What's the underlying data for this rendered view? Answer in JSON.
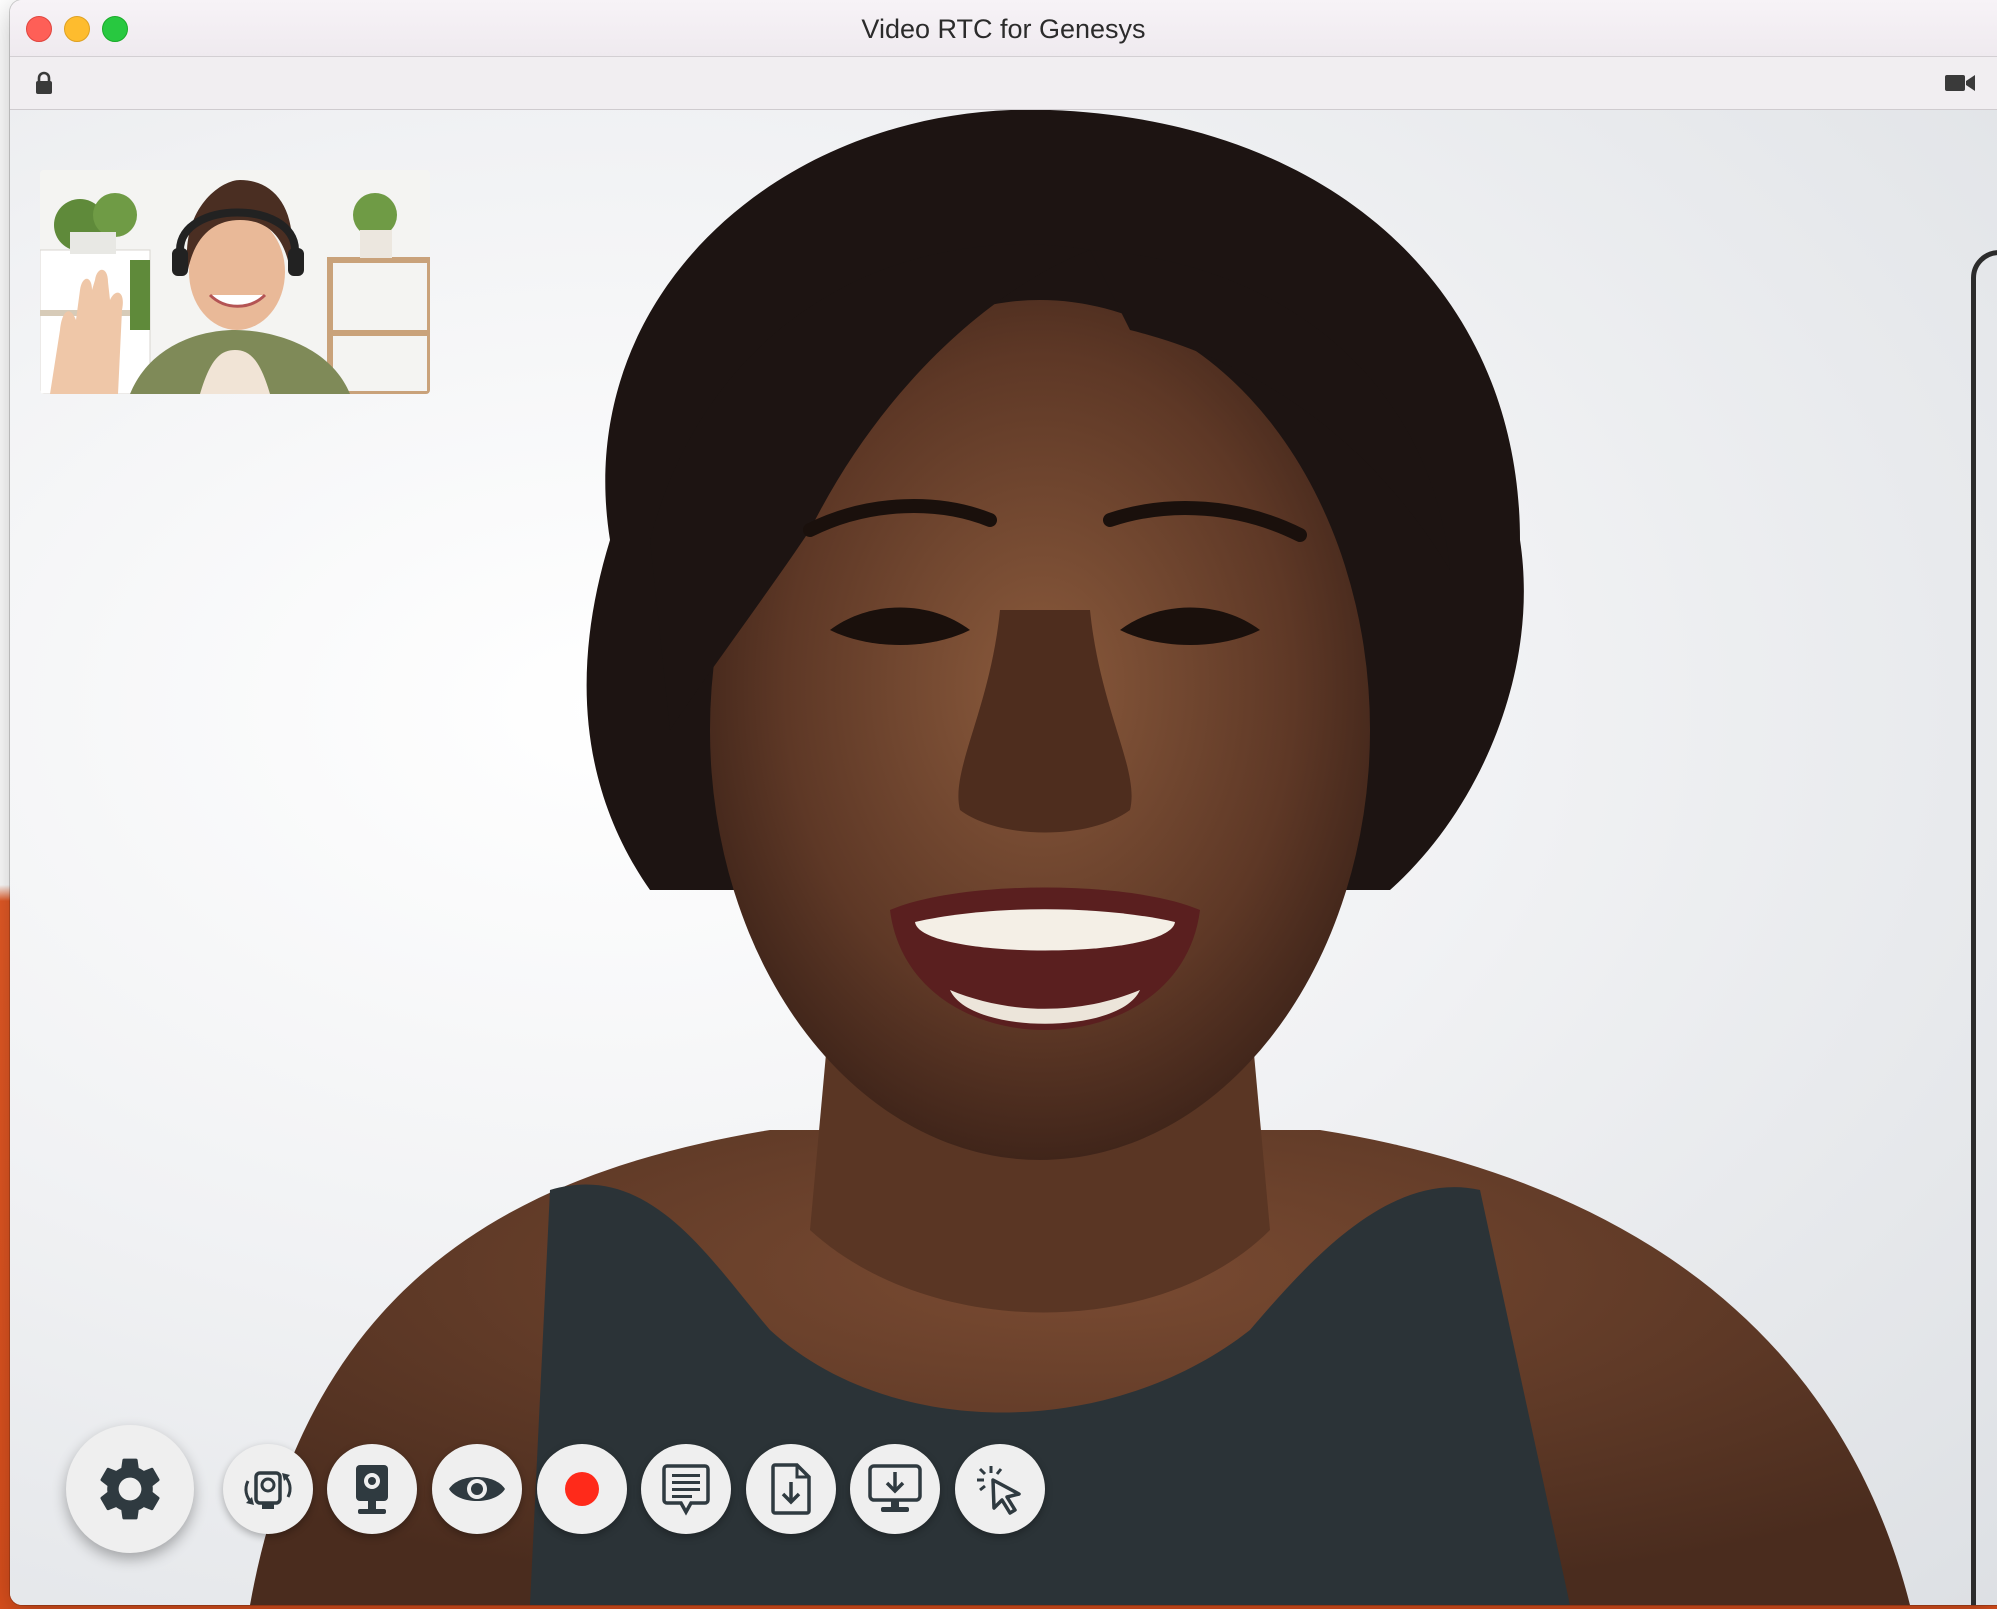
{
  "window": {
    "title": "Video RTC for Genesys"
  },
  "colors": {
    "record": "#ff2a1a",
    "icon": "#2f3a40",
    "background_accent": "#e45a26"
  },
  "toolbar": {
    "left_icon": "lock-icon",
    "right_icon": "video-camera-icon"
  },
  "controls": [
    {
      "id": "settings",
      "icon": "gear-icon"
    },
    {
      "id": "switch-camera",
      "icon": "switch-camera-icon"
    },
    {
      "id": "webcam",
      "icon": "webcam-icon"
    },
    {
      "id": "view",
      "icon": "eye-icon"
    },
    {
      "id": "record",
      "icon": "record-icon"
    },
    {
      "id": "chat",
      "icon": "chat-icon"
    },
    {
      "id": "file-download",
      "icon": "file-download-icon"
    },
    {
      "id": "screen-share",
      "icon": "screen-share-icon"
    },
    {
      "id": "pointer",
      "icon": "cursor-click-icon"
    }
  ]
}
